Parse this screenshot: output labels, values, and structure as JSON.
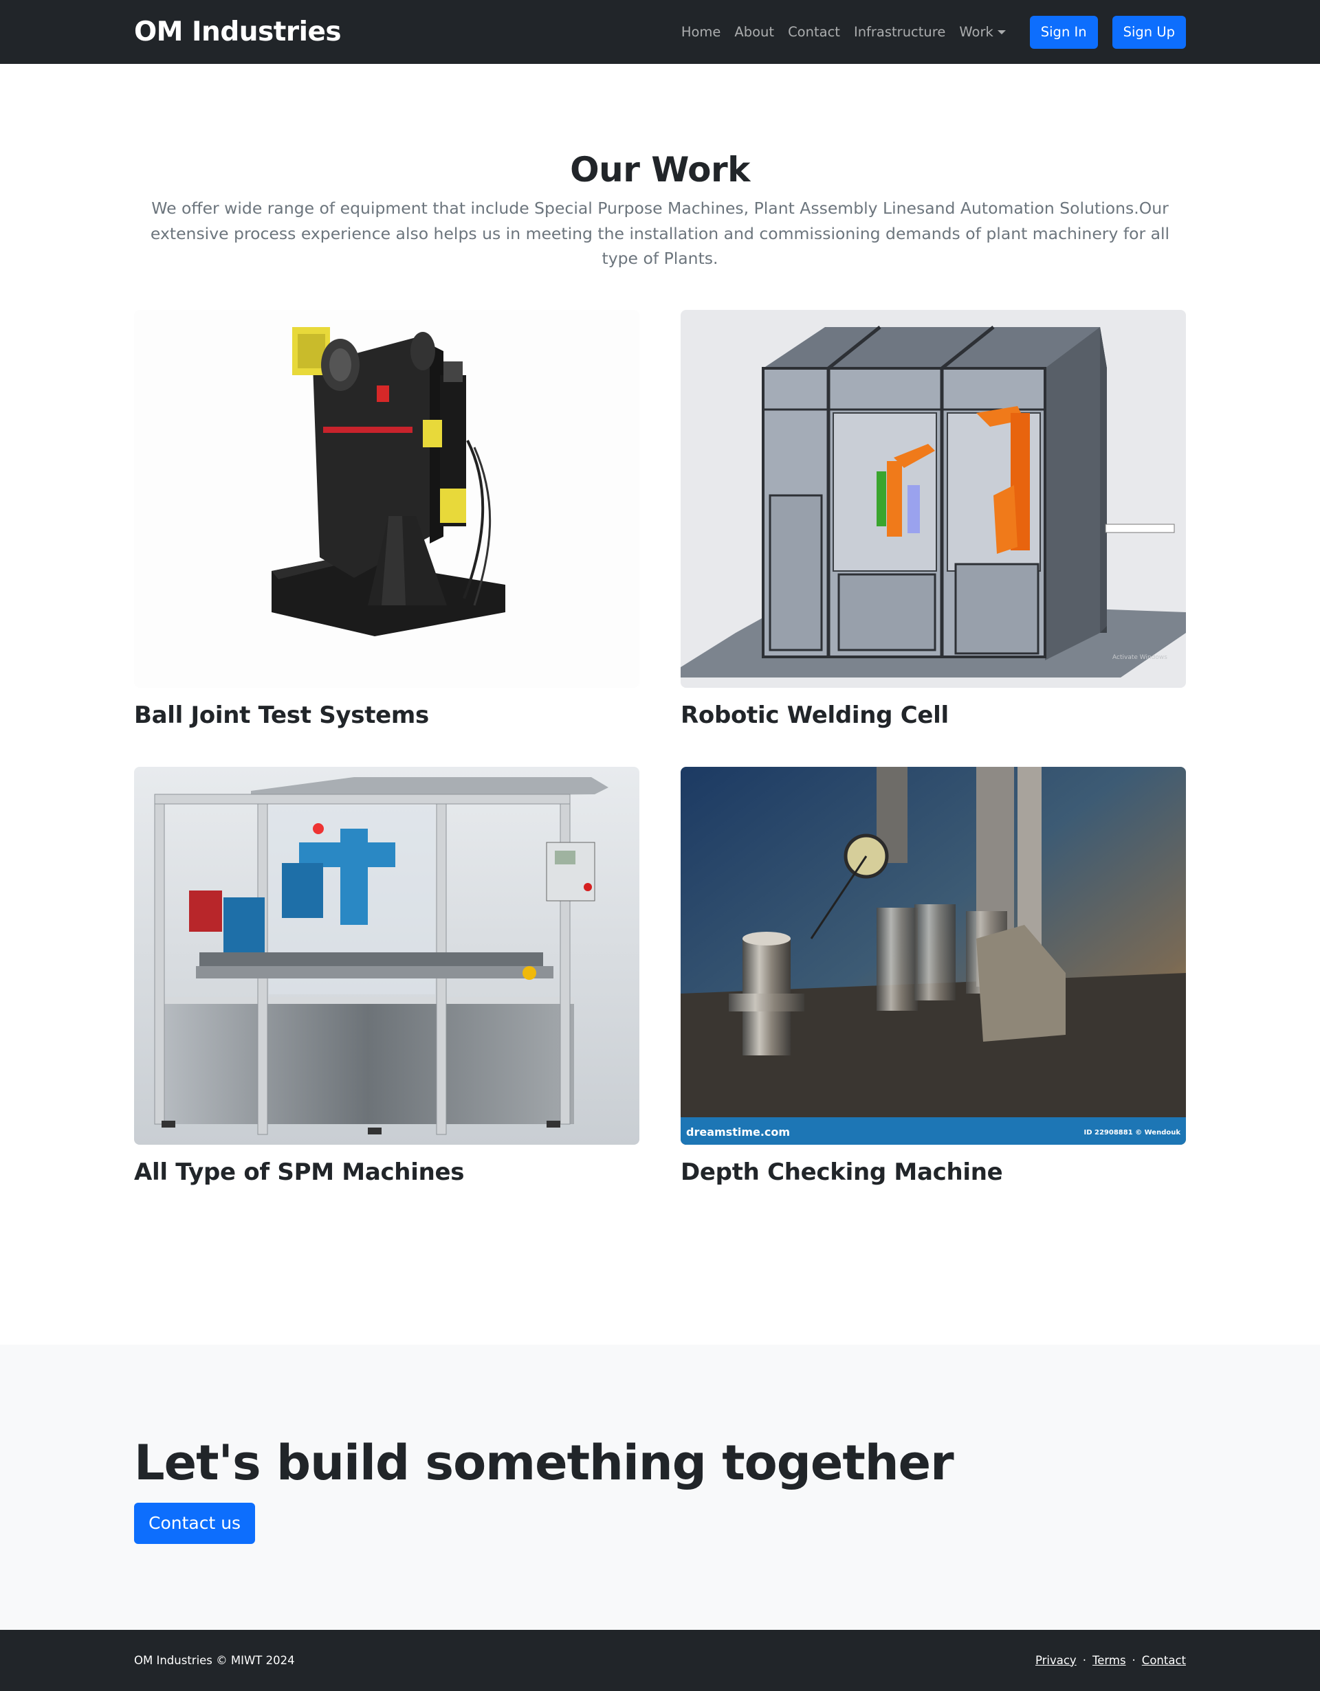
{
  "navbar": {
    "brand": "OM Industries",
    "links": [
      "Home",
      "About",
      "Contact",
      "Infrastructure"
    ],
    "work_dropdown": "Work",
    "sign_in": "Sign In",
    "sign_up": "Sign Up"
  },
  "work": {
    "title": "Our Work",
    "lead": "We offer wide range of equipment that include Special Purpose Machines, Plant Assembly Linesand Automation Solutions.Our extensive process experience also helps us in meeting the installation and commissioning demands of plant machinery for all type of Plants.",
    "cards": [
      {
        "title": "Ball Joint Test Systems"
      },
      {
        "title": "Robotic Welding Cell",
        "image_watermark": "Activate Windows"
      },
      {
        "title": "All Type of SPM Machines"
      },
      {
        "title": "Depth Checking Machine",
        "image_watermark_left": "dreamstime.com",
        "image_watermark_right": "ID 22908881 © Wendouk"
      }
    ]
  },
  "cta": {
    "title": "Let's build something together",
    "button": "Contact us"
  },
  "footer": {
    "copyright": "OM Industries © MIWT 2024",
    "links": [
      "Privacy",
      "Terms",
      "Contact"
    ],
    "separator": "·"
  },
  "colors": {
    "dark": "#212529",
    "primary": "#0d6efd",
    "muted": "#6c757d",
    "light": "#f8f9fa"
  }
}
